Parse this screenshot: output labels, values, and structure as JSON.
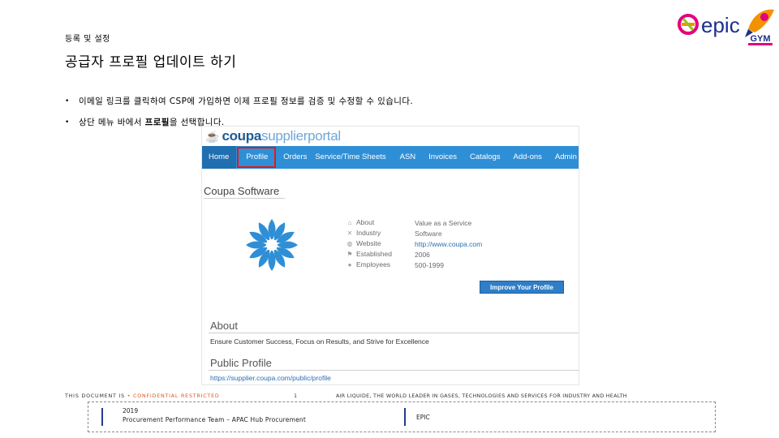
{
  "header": {
    "section_label": "등록 및 설정",
    "title": "공급자 프로필 업데이트 하기"
  },
  "bullets": [
    {
      "text": "이메일 링크를 클릭하여 CSP에 가입하면 이제 프로필 정보를 검증 및 수정할 수 있습니다."
    },
    {
      "prefix": "상단 메뉴 바에서 ",
      "bold": "프로필",
      "suffix": "을 선택합니다."
    }
  ],
  "logos": {
    "epic": "epic",
    "gym": "GYM"
  },
  "portal": {
    "logo_brand": "coupa",
    "logo_suffix": "supplierportal",
    "nav": [
      "Home",
      "Profile",
      "Orders",
      "Service/Time Sheets",
      "ASN",
      "Invoices",
      "Catalogs",
      "Add-ons",
      "Admin"
    ],
    "active_nav": "Home",
    "highlighted_nav": "Profile",
    "company_name": "Coupa Software",
    "info": [
      {
        "icon": "home-icon",
        "label": "About",
        "value": "Value as a Service",
        "link": false
      },
      {
        "icon": "wrench-icon",
        "label": "Industry",
        "value": "Software",
        "link": false
      },
      {
        "icon": "globe-icon",
        "label": "Website",
        "value": "http://www.coupa.com",
        "link": true
      },
      {
        "icon": "flag-icon",
        "label": "Established",
        "value": "2006",
        "link": false
      },
      {
        "icon": "people-icon",
        "label": "Employees",
        "value": "500-1999",
        "link": false
      }
    ],
    "improve_button": "Improve Your Profile",
    "about_title": "About",
    "about_text": "Ensure Customer Success, Focus on Results, and Strive for Excellence",
    "public_profile_title": "Public Profile",
    "public_profile_link": "https://supplier.coupa.com/public/profile"
  },
  "footer": {
    "doc_prefix": "THIS DOCUMENT IS ",
    "classification": "• CONFIDENTIAL RESTRICTED",
    "page_number": "1",
    "tagline": "AIR LIQUIDE, THE WORLD LEADER IN GASES, TECHNOLOGIES AND SERVICES FOR INDUSTRY AND HEALTH",
    "year": "2019",
    "team": "Procurement Performance Team – APAC Hub Procurement",
    "program": "EPIC"
  },
  "colors": {
    "nav_bar": "#2f8fd6",
    "nav_active": "#1f6fb1",
    "highlight": "#e01b1b",
    "confidential": "#e0561b",
    "footer_bar": "#1f3f88"
  }
}
